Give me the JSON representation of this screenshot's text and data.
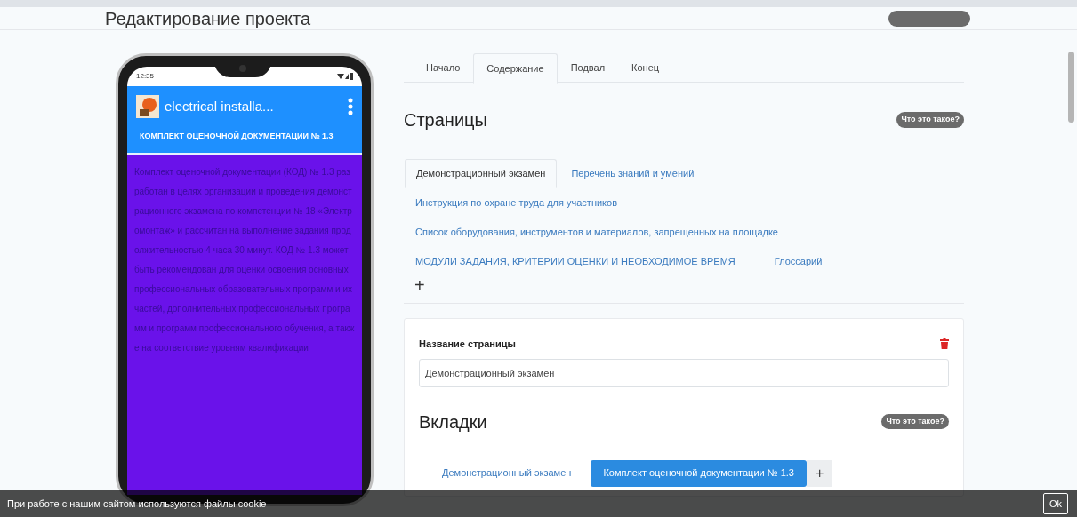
{
  "page": {
    "title": "Редактирование проекта"
  },
  "phone": {
    "time": "12:35",
    "app_title": "electrical installa...",
    "section_title": "КОМПЛЕКТ ОЦЕНОЧНОЙ ДОКУМЕНТАЦИИ № 1.3",
    "body": "Комплект оценочной документации (КОД) № 1.3 разработан в целях организации и проведения демонстрационного экзамена по компетенции № 18 «Электромонтаж» и рассчитан на выполнение задания продолжительностью 4 часа 30 минут. КОД № 1.3 может быть рекомендован для оценки освоения основных профессиональных образовательных программ и их частей, дополнительных профессиональных программ и программ профессионального обучения, а также на соответствие уровням квалификации"
  },
  "tabs": [
    {
      "label": "Начало",
      "selected": false
    },
    {
      "label": "Содержание",
      "selected": true
    },
    {
      "label": "Подвал",
      "selected": false
    },
    {
      "label": "Конец",
      "selected": false
    }
  ],
  "pages_section": {
    "heading": "Страницы",
    "help": "Что это такое?",
    "add": "+",
    "pages": [
      {
        "label": "Демонстрационный экзамен",
        "selected": true
      },
      {
        "label": "Перечень знаний и умений",
        "selected": false
      },
      {
        "label": "Инструкция по охране труда для участников",
        "selected": false
      },
      {
        "label": "Список оборудования, инструментов и материалов, запрещенных на площадке",
        "selected": false
      },
      {
        "label": "МОДУЛИ ЗАДАНИЯ, КРИТЕРИИ ОЦЕНКИ И НЕОБХОДИМОЕ ВРЕМЯ",
        "selected": false
      },
      {
        "label": "Глоссарий",
        "selected": false
      }
    ]
  },
  "page_editor": {
    "name_label": "Название страницы",
    "name_value": "Демонстрационный экзамен",
    "tabs_heading": "Вкладки",
    "help": "Что это такое?",
    "add": "+",
    "tabs": [
      {
        "label": "Демонстрационный экзамен",
        "selected": false
      },
      {
        "label": "Комплект оценочной документации № 1.3",
        "selected": true
      }
    ]
  },
  "cookie_bar": {
    "text": "При работе с нашим сайтом используются файлы cookie",
    "button": "Ok"
  }
}
